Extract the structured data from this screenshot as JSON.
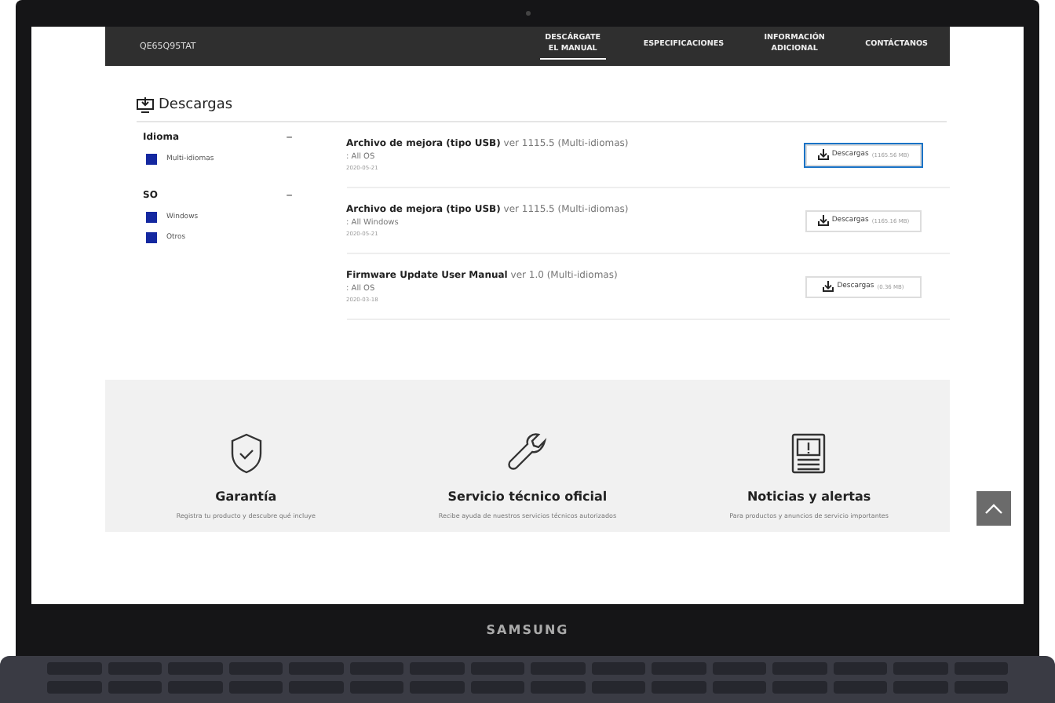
{
  "nav": {
    "model": "QE65Q95TAT",
    "links": [
      {
        "label": "DESCÁRGATE EL MANUAL",
        "selected": true
      },
      {
        "label": "ESPECIFICACIONES",
        "selected": false
      },
      {
        "label": "INFORMACIÓN ADICIONAL",
        "selected": false
      },
      {
        "label": "CONTÁCTANOS",
        "selected": false
      }
    ]
  },
  "downloads": {
    "title": "Descargas",
    "filters": [
      {
        "title": "Idioma",
        "toggle": "–",
        "options": [
          {
            "label": "Multi-idiomas",
            "checked": true
          }
        ]
      },
      {
        "title": "SO",
        "toggle": "–",
        "options": [
          {
            "label": "Windows",
            "checked": true
          },
          {
            "label": "Otros",
            "checked": true
          }
        ]
      }
    ],
    "files": [
      {
        "name": "Archivo de mejora (tipo USB)",
        "version": "ver 1115.5 (Multi-idiomas)",
        "os": ": All OS",
        "date": "2020-05-21",
        "button": "Descargas",
        "size": "(1165.56 MB)",
        "selected": true
      },
      {
        "name": "Archivo de mejora (tipo USB)",
        "version": "ver 1115.5 (Multi-idiomas)",
        "os": ": All Windows",
        "date": "2020-05-21",
        "button": "Descargas",
        "size": "(1165.16 MB)",
        "selected": false
      },
      {
        "name": "Firmware Update User Manual",
        "version": "ver 1.0 (Multi-idiomas)",
        "os": ": All OS",
        "date": "2020-03-18",
        "button": "Descargas",
        "size": "(0.36 MB)",
        "selected": false
      }
    ]
  },
  "services": [
    {
      "kind": "shield",
      "title": "Garantía",
      "text": "Registra tu producto y descubre qué incluye"
    },
    {
      "kind": "wrench",
      "title": "Servicio técnico oficial",
      "text": "Recibe ayuda de nuestros servicios técnicos autorizados"
    },
    {
      "kind": "news",
      "title": "Noticias y alertas",
      "text": "Para productos y anuncios de servicio importantes"
    }
  ],
  "laptop": {
    "brand": "SAMSUNG"
  }
}
